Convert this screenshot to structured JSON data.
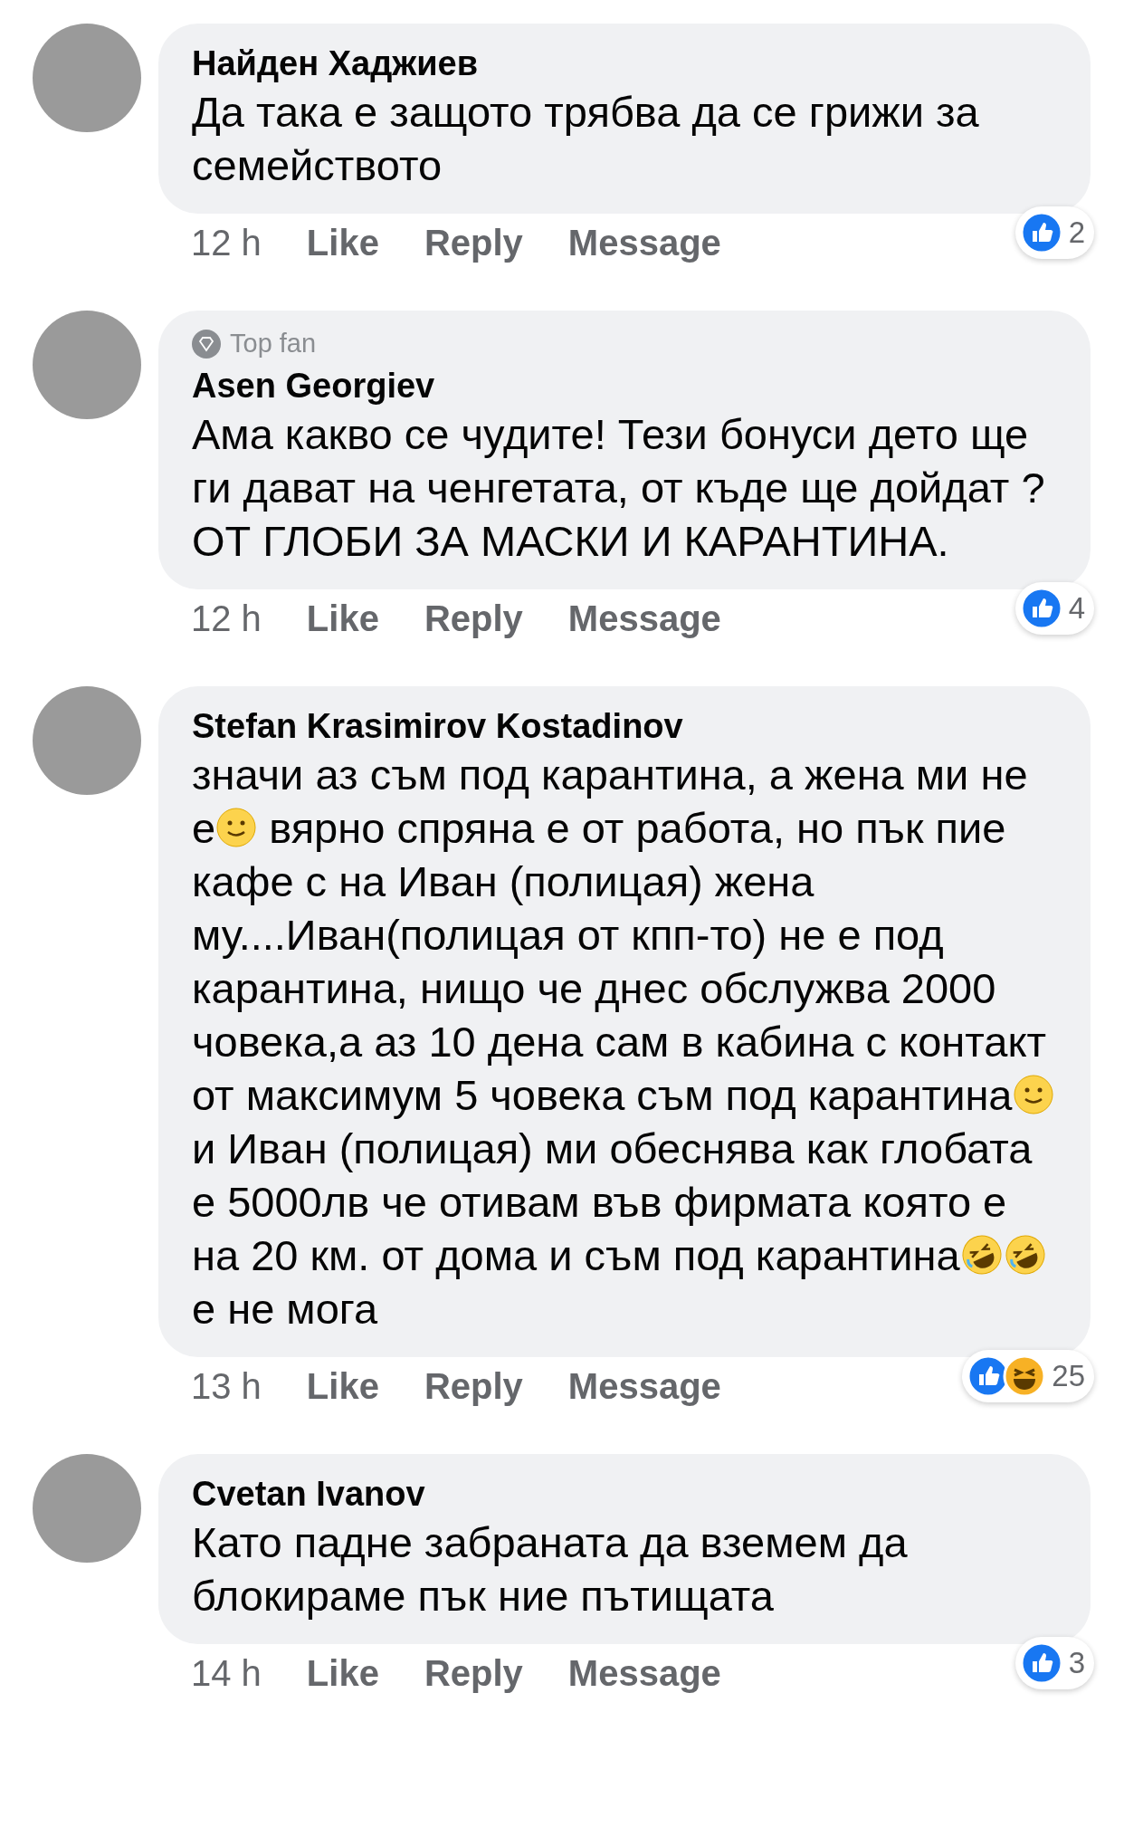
{
  "comments": [
    {
      "author": "Найден Хаджиев",
      "top_fan": false,
      "body": [
        {
          "kind": "text",
          "text": "Да така е защото трябва да се грижи за семейството"
        }
      ],
      "time": "12 h",
      "actions": [
        "Like",
        "Reply",
        "Message"
      ],
      "reactions": {
        "icons": [
          {
            "kind": "like"
          }
        ],
        "count": "2"
      }
    },
    {
      "author": "Asen Georgiev",
      "top_fan": true,
      "badge_label": "Top fan",
      "body": [
        {
          "kind": "text",
          "text": "Ама какво се чудите!  Тези бонуси дето ще ги дават на ченгетата, от къде ще дойдат ? ОТ ГЛОБИ ЗА МАСКИ И КАРАНТИНА."
        }
      ],
      "time": "12 h",
      "actions": [
        "Like",
        "Reply",
        "Message"
      ],
      "reactions": {
        "icons": [
          {
            "kind": "like"
          }
        ],
        "count": "4"
      }
    },
    {
      "author": "Stefan Krasimirov Kostadinov",
      "top_fan": false,
      "body": [
        {
          "kind": "text",
          "text": "значи аз съм под карантина, а жена ми не е"
        },
        {
          "kind": "smile"
        },
        {
          "kind": "text",
          "text": " вярно спряна е от работа, но пък пие кафе с на Иван (полицая) жена му....Иван(полицая от кпп-то) не е под карантина, нищо че днес обслужва 2000 човека,а аз 10 дена сам в кабина с контакт от максимум 5 човека съм под карантина"
        },
        {
          "kind": "smile"
        },
        {
          "kind": "text",
          "text": " и Иван (полицая) ми обеснява как глобата е 5000лв че отивам във фирмата която е на 20 км. от дома и съм под карантина"
        },
        {
          "kind": "rofl"
        },
        {
          "kind": "rofl"
        },
        {
          "kind": "text",
          "text": " е не мога"
        }
      ],
      "time": "13 h",
      "actions": [
        "Like",
        "Reply",
        "Message"
      ],
      "reactions": {
        "icons": [
          {
            "kind": "like"
          },
          {
            "kind": "haha"
          }
        ],
        "count": "25"
      }
    },
    {
      "author": "Cvetan Ivanov",
      "top_fan": false,
      "body": [
        {
          "kind": "text",
          "text": "Като падне забраната да вземем да блокираме пък ние пътищата"
        }
      ],
      "time": "14 h",
      "actions": [
        "Like",
        "Reply",
        "Message"
      ],
      "reactions": {
        "icons": [
          {
            "kind": "like"
          }
        ],
        "count": "3"
      }
    }
  ]
}
